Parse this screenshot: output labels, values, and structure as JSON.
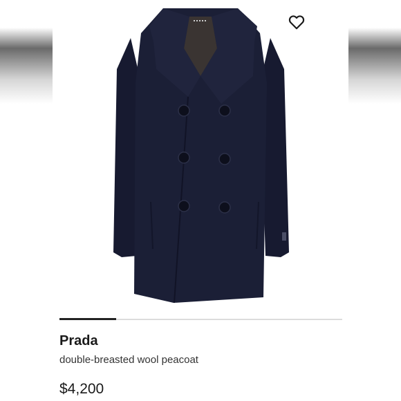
{
  "product": {
    "brand": "Prada",
    "description": "double-breasted wool peacoat",
    "price": "$4,200",
    "image_icon": "peacoat-image",
    "coat_color": "#1b1f36",
    "favorite_icon": "heart-outline-icon"
  },
  "gallery": {
    "progress_fraction": 0.2
  }
}
